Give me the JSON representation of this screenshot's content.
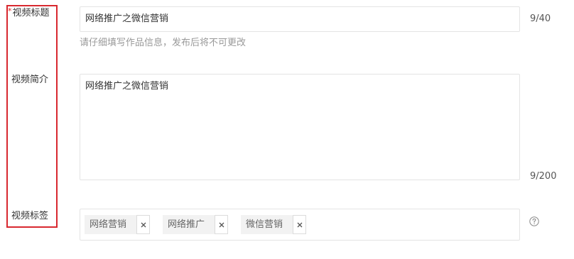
{
  "fields": {
    "title": {
      "required_mark": "*",
      "label": "视频标题",
      "value": "网络推广之微信营销",
      "counter": "9/40",
      "hint": "请仔细填写作品信息，发布后将不可更改"
    },
    "intro": {
      "label": "视频简介",
      "value": "网络推广之微信营销",
      "counter": "9/200"
    },
    "tags": {
      "label": "视频标签",
      "items": [
        {
          "label": "网络营销"
        },
        {
          "label": "网络推广"
        },
        {
          "label": "微信营销"
        }
      ],
      "help_icon": "question-circle-icon"
    }
  },
  "colors": {
    "highlight_border": "#d8282f",
    "required": "#e2231a",
    "hint_text": "#999999",
    "tag_background": "#f2f2f2"
  }
}
